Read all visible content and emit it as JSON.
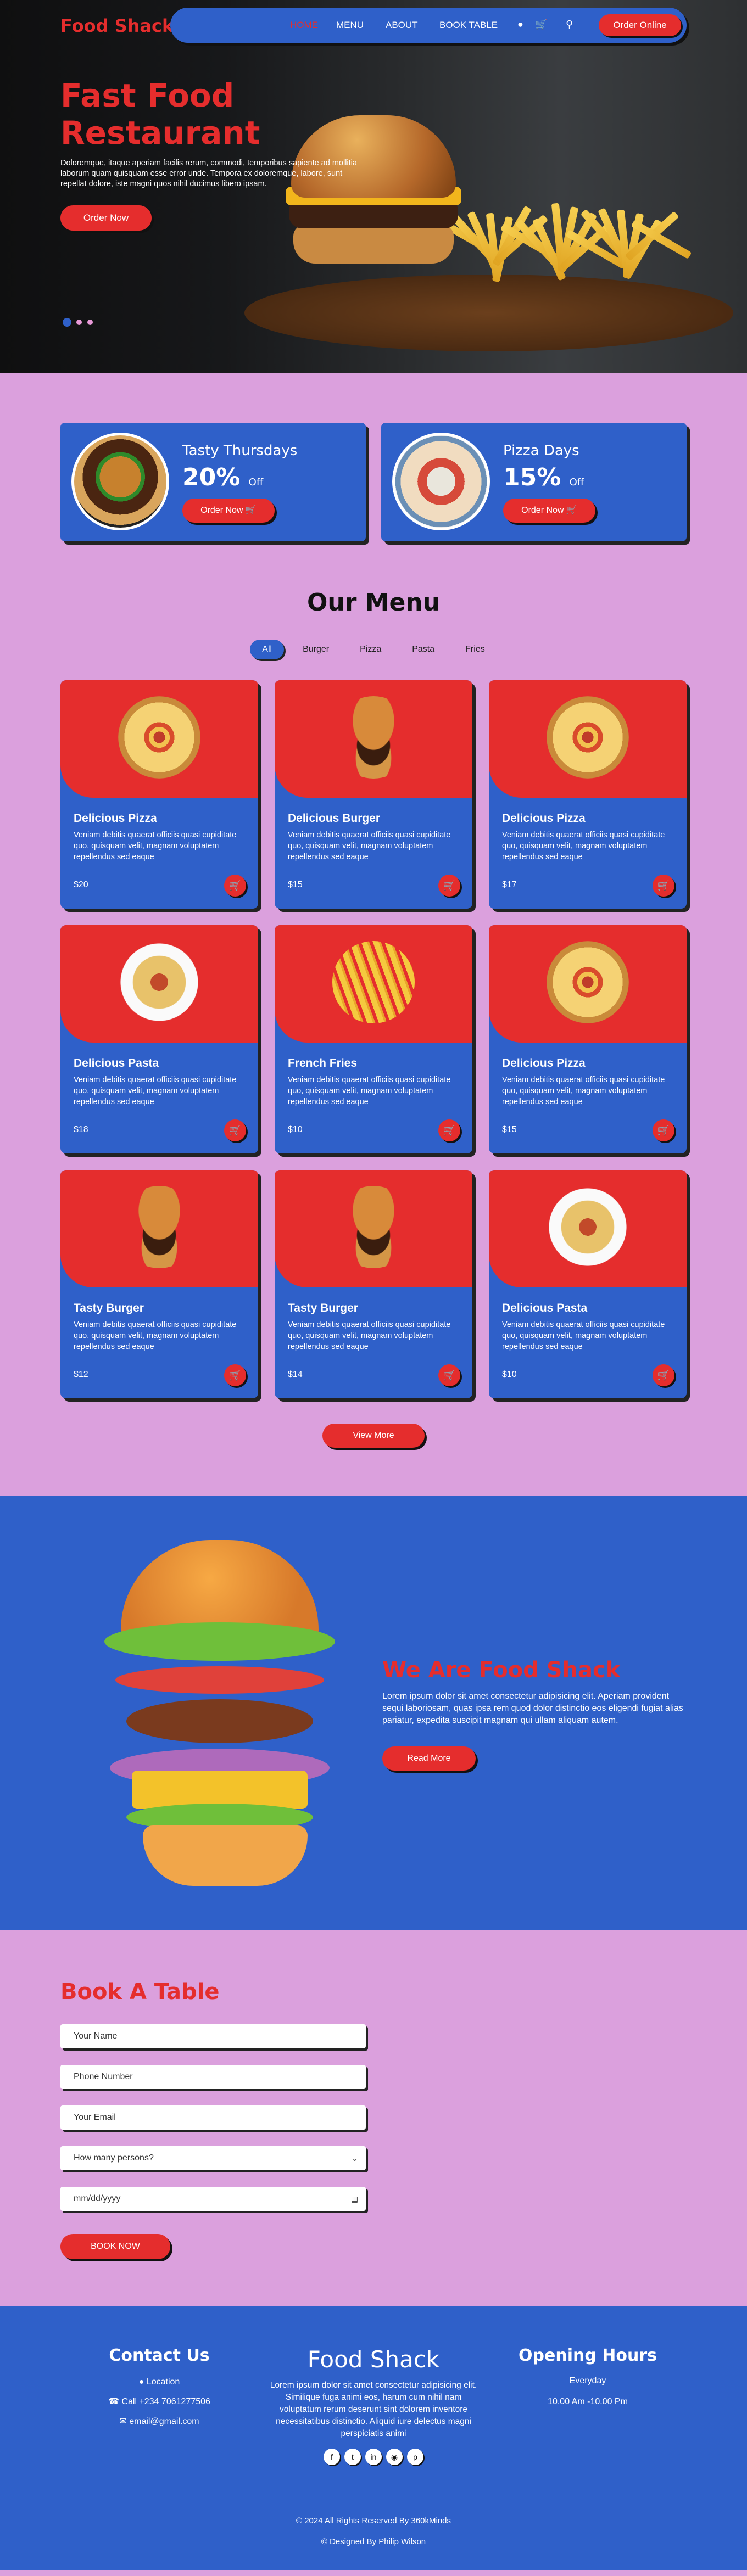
{
  "brand": "Food Shack",
  "nav": {
    "links": [
      "HOME",
      "MENU",
      "ABOUT",
      "BOOK TABLE"
    ],
    "active_index": 0,
    "user_icon": "user-icon",
    "cart_icon": "cart-icon",
    "search_icon": "search-icon",
    "order_online": "Order Online"
  },
  "hero": {
    "title": "Fast Food Restaurant",
    "text": "Doloremque, itaque aperiam facilis rerum, commodi, temporibus sapiente ad mollitia laborum quam quisquam esse error unde. Tempora ex doloremque, labore, sunt repellat dolore, iste magni quos nihil ducimus libero ipsam.",
    "button": "Order Now",
    "slides": 3,
    "active_slide": 1
  },
  "promos": [
    {
      "title": "Tasty Thursdays",
      "percent": "20%",
      "off": "Off",
      "button": "Order Now"
    },
    {
      "title": "Pizza Days",
      "percent": "15%",
      "off": "Off",
      "button": "Order Now"
    }
  ],
  "menu": {
    "title": "Our Menu",
    "filters": [
      "All",
      "Burger",
      "Pizza",
      "Pasta",
      "Fries"
    ],
    "active_filter": "All",
    "items": [
      {
        "name": "Delicious Pizza",
        "desc": "Veniam debitis quaerat officiis quasi cupiditate quo, quisquam velit, magnam voluptatem repellendus sed eaque",
        "price": "$20",
        "food": "pizza"
      },
      {
        "name": "Delicious Burger",
        "desc": "Veniam debitis quaerat officiis quasi cupiditate quo, quisquam velit, magnam voluptatem repellendus sed eaque",
        "price": "$15",
        "food": "burger"
      },
      {
        "name": "Delicious Pizza",
        "desc": "Veniam debitis quaerat officiis quasi cupiditate quo, quisquam velit, magnam voluptatem repellendus sed eaque",
        "price": "$17",
        "food": "pizza"
      },
      {
        "name": "Delicious Pasta",
        "desc": "Veniam debitis quaerat officiis quasi cupiditate quo, quisquam velit, magnam voluptatem repellendus sed eaque",
        "price": "$18",
        "food": "pasta"
      },
      {
        "name": "French Fries",
        "desc": "Veniam debitis quaerat officiis quasi cupiditate quo, quisquam velit, magnam voluptatem repellendus sed eaque",
        "price": "$10",
        "food": "fries"
      },
      {
        "name": "Delicious Pizza",
        "desc": "Veniam debitis quaerat officiis quasi cupiditate quo, quisquam velit, magnam voluptatem repellendus sed eaque",
        "price": "$15",
        "food": "pizza"
      },
      {
        "name": "Tasty Burger",
        "desc": "Veniam debitis quaerat officiis quasi cupiditate quo, quisquam velit, magnam voluptatem repellendus sed eaque",
        "price": "$12",
        "food": "burger"
      },
      {
        "name": "Tasty Burger",
        "desc": "Veniam debitis quaerat officiis quasi cupiditate quo, quisquam velit, magnam voluptatem repellendus sed eaque",
        "price": "$14",
        "food": "burger"
      },
      {
        "name": "Delicious Pasta",
        "desc": "Veniam debitis quaerat officiis quasi cupiditate quo, quisquam velit, magnam voluptatem repellendus sed eaque",
        "price": "$10",
        "food": "pasta"
      }
    ],
    "view_more": "View More"
  },
  "about": {
    "title": "We Are Food Shack",
    "text": "Lorem ipsum dolor sit amet consectetur adipisicing elit. Aperiam provident sequi laboriosam, quas ipsa rem quod dolor distinctio eos eligendi fugiat alias pariatur, expedita suscipit magnam qui ullam aliquam autem.",
    "button": "Read More"
  },
  "book": {
    "title": "Book A Table",
    "name_placeholder": "Your Name",
    "phone_placeholder": "Phone Number",
    "email_placeholder": "Your Email",
    "persons_placeholder": "How many persons?",
    "date_placeholder": "mm/dd/yyyy",
    "button": "BOOK NOW"
  },
  "footer": {
    "contact_title": "Contact Us",
    "location": "Location",
    "phone": "Call +234 7061277506",
    "email": "email@gmail.com",
    "brand": "Food Shack",
    "about_text": "Lorem ipsum dolor sit amet consectetur adipisicing elit. Similique fuga animi eos, harum cum nihil nam voluptatum rerum deserunt sint dolorem inventore necessitatibus distinctio. Aliquid iure delectus magni perspiciatis animi",
    "hours_title": "Opening Hours",
    "hours_days": "Everyday",
    "hours_time": "10.00 Am -10.00 Pm",
    "socials": [
      "facebook-icon",
      "twitter-icon",
      "linkedin-icon",
      "instagram-icon",
      "pinterest-icon"
    ],
    "copyright": "© 2024 All Rights Reserved By 360kMinds",
    "designed": "© Designed By Philip Wilson"
  },
  "colors": {
    "red": "#e52d2d",
    "blue": "#2f60c9",
    "pink": "#dba0dd"
  }
}
